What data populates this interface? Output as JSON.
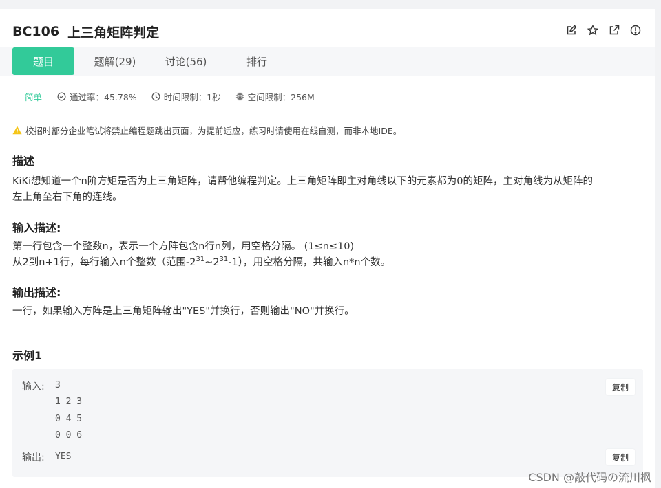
{
  "problem": {
    "id": "BC106",
    "title": "上三角矩阵判定"
  },
  "tabs": [
    {
      "label": "题目",
      "active": true
    },
    {
      "label": "题解(29)",
      "active": false
    },
    {
      "label": "讨论(56)",
      "active": false
    },
    {
      "label": "排行",
      "active": false
    }
  ],
  "meta": {
    "difficulty": "简单",
    "pass_rate": "通过率：45.78%",
    "time_limit": "时间限制：1秒",
    "space_limit": "空间限制：256M"
  },
  "notice": "校招时部分企业笔试将禁止编程题跳出页面，为提前适应，练习时请使用在线自测，而非本地IDE。",
  "description": {
    "heading": "描述",
    "line1": "KiKi想知道一个n阶方矩是否为上三角矩阵，请帮他编程判定。上三角矩阵即主对角线以下的元素都为0的矩阵，主对角线为从矩阵的",
    "line2": "左上角至右下角的连线。"
  },
  "input_desc": {
    "heading": "输入描述:",
    "line1": "第一行包含一个整数n，表示一个方阵包含n行n列，用空格分隔。 (1≤n≤10)",
    "line2_a": "从2到n+1行，每行输入n个整数（范围-2",
    "line2_sup1": "31",
    "line2_b": "~2",
    "line2_sup2": "31",
    "line2_c": "-1），用空格分隔，共输入n*n个数。"
  },
  "output_desc": {
    "heading": "输出描述:",
    "line1": "一行，如果输入方阵是上三角矩阵输出\"YES\"并换行，否则输出\"NO\"并换行。"
  },
  "example": {
    "heading": "示例1",
    "input_label": "输入:",
    "input_value": "3\n1 2 3\n0 4 5\n0 0 6",
    "output_label": "输出:",
    "output_value": "YES",
    "copy_label": "复制"
  },
  "watermark": "CSDN @敲代码の流川枫",
  "icons": [
    "edit-icon",
    "star-icon",
    "share-icon",
    "info-icon",
    "check-circle-icon",
    "clock-icon",
    "chip-icon",
    "warning-icon"
  ],
  "colors": {
    "accent": "#32ca99",
    "warning": "#f5c518"
  }
}
